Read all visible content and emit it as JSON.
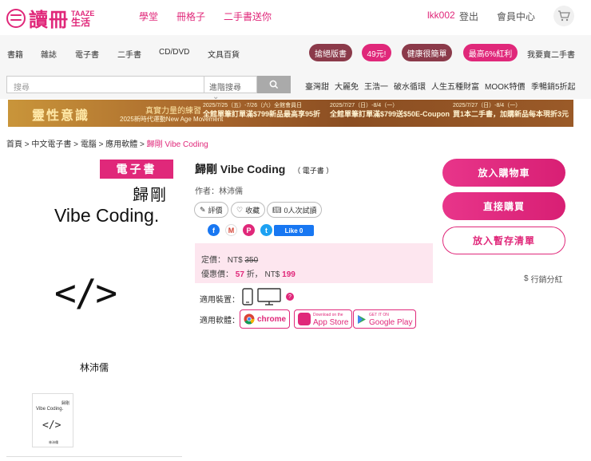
{
  "header": {
    "logo_cn": "讀冊",
    "logo_en": "TAAZE",
    "logo_sub": "生活",
    "nav": [
      "學堂",
      "冊格子",
      "二手書送你"
    ],
    "username": "lkk002",
    "logout": "登出",
    "member": "會員中心"
  },
  "categories": [
    "書籍",
    "雜誌",
    "電子書",
    "二手書",
    "CD/DVD",
    "文具百貨"
  ],
  "promos": [
    {
      "label": "搶絕版書",
      "color": "#8b3a4a"
    },
    {
      "label": "49元!",
      "color": "#e0287a"
    },
    {
      "label": "健康很簡單",
      "color": "#8b3a4a"
    },
    {
      "label": "最高6%紅利",
      "color": "#e0287a"
    }
  ],
  "sell_used": "我要賣二手書",
  "search": {
    "placeholder": "搜尋",
    "scope": "進階搜尋",
    "hot_terms": [
      "臺灣甜",
      "大麗免",
      "王浩一",
      "破水循環",
      "人生五種財富",
      "MOOK特價",
      "季暢銷5折起"
    ]
  },
  "banner": {
    "title": "靈性意識",
    "tagline": "真實力量的練習",
    "subline": "2025新時代運動New Age Movement",
    "segments": [
      {
        "date": "2025/7/25（五）-7/26（六）全館會員日",
        "text": "全館單筆訂單滿$799新品最高享95折"
      },
      {
        "date": "2025/7/27（日）-8/4（一）",
        "text": "全館單筆訂單滿$799送$50E-Coupon"
      },
      {
        "date": "2025/7/27（日）-8/4（一）",
        "text": "買1本二手書，加購新品每本現折3元"
      }
    ]
  },
  "breadcrumb": {
    "items": [
      "首頁",
      "中文電子書",
      "電腦",
      "應用軟體"
    ],
    "current": "歸剛 Vibe Coding"
  },
  "cover": {
    "tag": "電子書",
    "title_cn": "歸剛",
    "title_en": "Vibe Coding.",
    "code": "</>",
    "author": "林沛儒",
    "thumb_title_cn": "歸剛",
    "thumb_title_en": "Vibe Coding.",
    "thumb_code": "</>",
    "thumb_author": "林沛儒"
  },
  "book": {
    "title": "歸剛 Vibe Coding",
    "format": "（ 電子書 ）",
    "author_label": "作者：林沛儒",
    "rate_label": "評價",
    "fav_label": "收藏",
    "trial_label": "0人次試讀",
    "fb_like": "Like 0"
  },
  "price": {
    "list_label": "定價：",
    "list_currency": "NT$",
    "list_value": "350",
    "sale_label": "優惠價：",
    "discount": "57",
    "discount_unit": "折，",
    "sale_currency": "NT$",
    "sale_value": "199"
  },
  "devices": {
    "label": "適用裝置：",
    "help": "?"
  },
  "apps": {
    "label": "適用軟體：",
    "items": [
      "chrome",
      "App Store",
      "Google Play"
    ],
    "app_store_top": "Download on the",
    "google_top": "GET IT ON"
  },
  "actions": {
    "add_cart": "放入購物車",
    "buy_now": "直接購買",
    "wishlist": "放入暫存清單",
    "affiliate": "行銷分紅"
  }
}
